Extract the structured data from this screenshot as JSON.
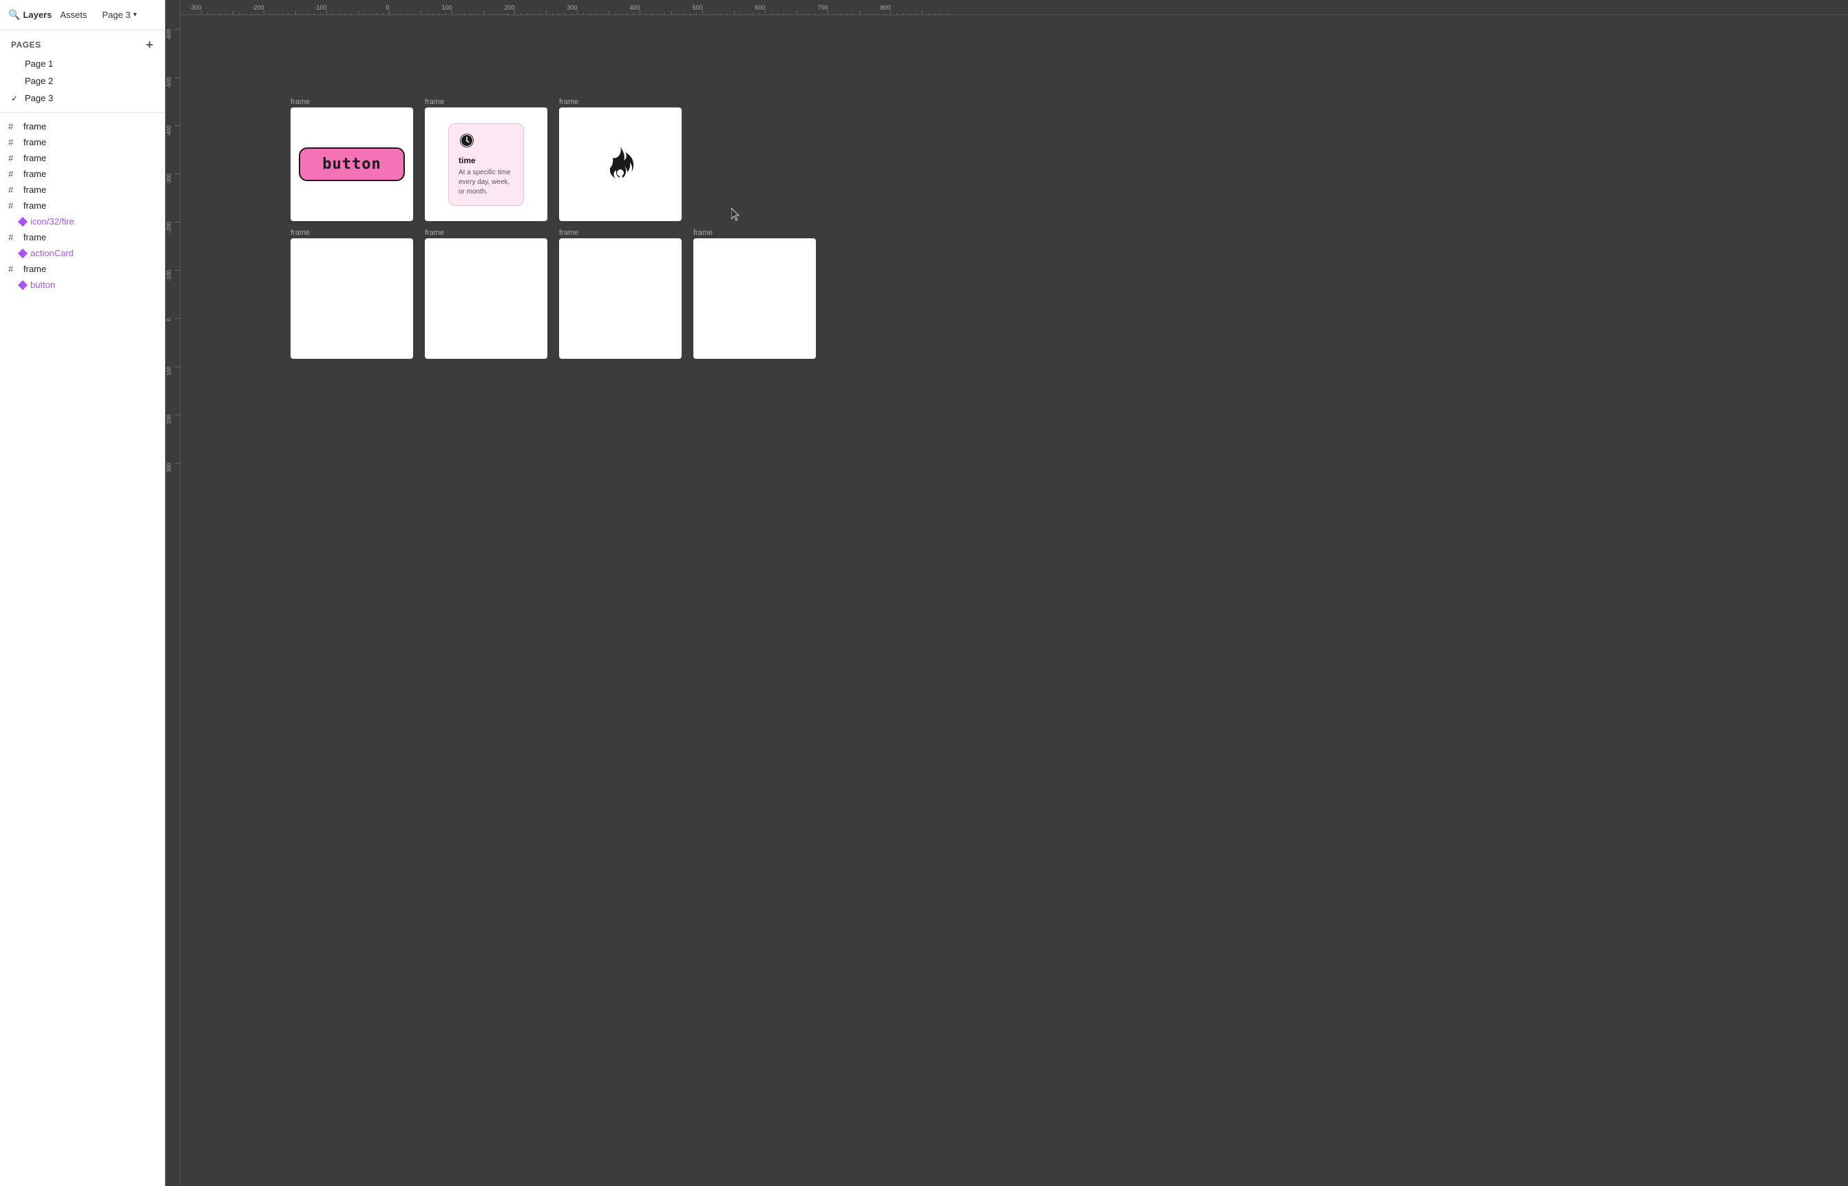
{
  "topbar": {
    "layers_label": "Layers",
    "assets_label": "Assets",
    "page_label": "Page 3",
    "search_icon": "🔍"
  },
  "pages": {
    "section_label": "Pages",
    "add_icon": "+",
    "items": [
      {
        "label": "Page 1",
        "active": false
      },
      {
        "label": "Page 2",
        "active": false
      },
      {
        "label": "Page 3",
        "active": true
      }
    ]
  },
  "layers": [
    {
      "type": "grid",
      "label": "frame",
      "level": 0
    },
    {
      "type": "grid",
      "label": "frame",
      "level": 0
    },
    {
      "type": "grid",
      "label": "frame",
      "level": 0
    },
    {
      "type": "grid",
      "label": "frame",
      "level": 0
    },
    {
      "type": "grid",
      "label": "frame",
      "level": 0
    },
    {
      "type": "grid",
      "label": "frame",
      "level": 0,
      "child": "icon/32/fire"
    },
    {
      "type": "grid",
      "label": "frame",
      "level": 0,
      "child": "actionCard"
    },
    {
      "type": "grid",
      "label": "frame",
      "level": 0,
      "child": "button"
    }
  ],
  "canvas": {
    "frames_row1": [
      {
        "label": "frame",
        "type": "button"
      },
      {
        "label": "frame",
        "type": "timecard"
      },
      {
        "label": "frame",
        "type": "fire"
      }
    ],
    "frames_row2": [
      {
        "label": "frame",
        "type": "empty"
      },
      {
        "label": "frame",
        "type": "empty"
      },
      {
        "label": "frame",
        "type": "empty"
      },
      {
        "label": "frame",
        "type": "empty"
      }
    ]
  },
  "ruler": {
    "h_ticks": [
      "-300",
      "-200",
      "-100",
      "0",
      "100",
      "200",
      "300",
      "400",
      "500",
      "600",
      "700",
      "800"
    ],
    "v_ticks": [
      "-600",
      "-500",
      "-400",
      "-300",
      "-200",
      "-100",
      "0",
      "100",
      "200",
      "300"
    ]
  },
  "button_content": {
    "label": "button"
  },
  "timecard": {
    "title": "time",
    "description": "At a specific time every day, week, or month."
  }
}
